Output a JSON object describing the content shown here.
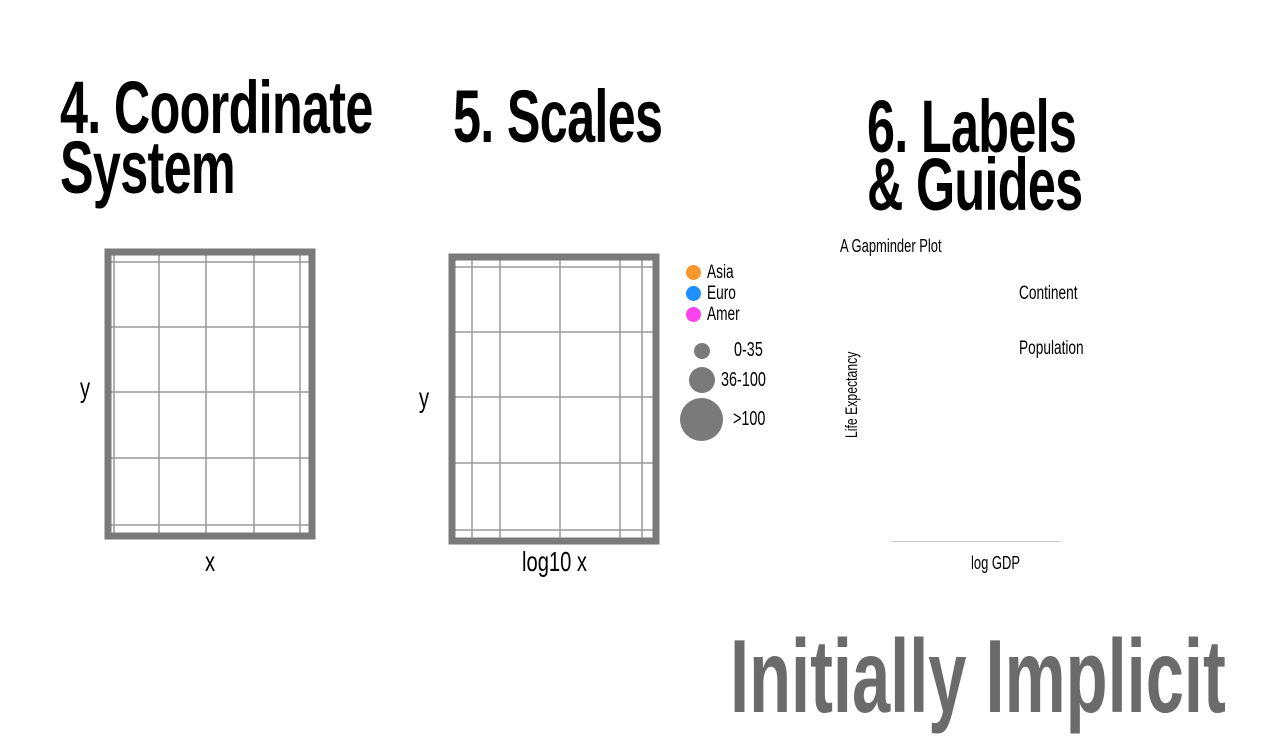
{
  "colors": {
    "frame": "#7a7a7a",
    "grid": "#9a9a9a",
    "asia": "#f7972f",
    "euro": "#1e90ff",
    "amer": "#ff44ee",
    "size_dot": "#7a7a7a",
    "footer": "#6b6b6b",
    "axis_line": "#cccccc"
  },
  "sections": {
    "coord": {
      "title_line1": "4. Coordinate",
      "title_line2": "System",
      "y_label": "y",
      "x_label": "x"
    },
    "scales": {
      "title": "5. Scales",
      "y_label": "y",
      "x_label": "log10 x",
      "color_legend": [
        "Asia",
        "Euro",
        "Amer"
      ],
      "size_legend": [
        "0-35",
        "36-100",
        ">100"
      ]
    },
    "labels": {
      "title_line1": "6. Labels",
      "title_line2": "& Guides",
      "plot_title": "A Gapminder Plot",
      "legend_title_color": "Continent",
      "legend_title_size": "Population",
      "y_label": "Life Expectancy",
      "x_label": "log GDP"
    }
  },
  "footer": "Initially Implicit"
}
